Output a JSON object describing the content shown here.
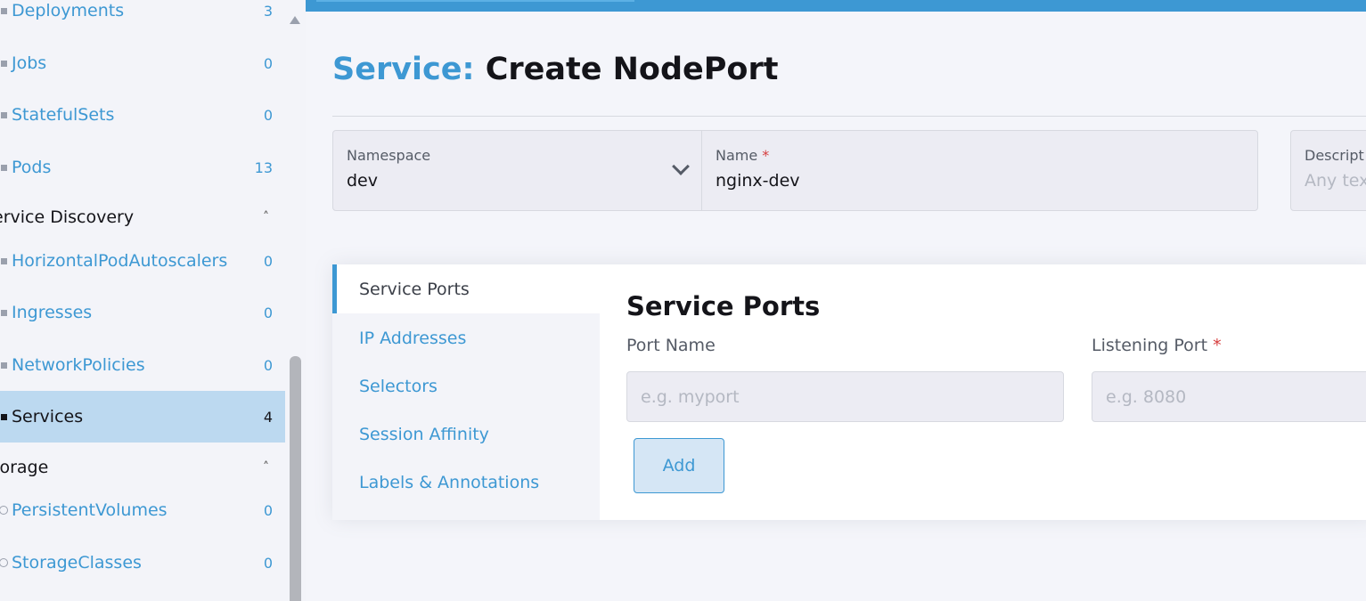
{
  "sidebar": {
    "items": [
      {
        "label": "Deployments",
        "count": "3"
      },
      {
        "label": "Jobs",
        "count": "0"
      },
      {
        "label": "StatefulSets",
        "count": "0"
      },
      {
        "label": "Pods",
        "count": "13"
      }
    ],
    "groups": [
      {
        "label": "ervice Discovery",
        "items": [
          {
            "label": "HorizontalPodAutoscalers",
            "count": "0"
          },
          {
            "label": "Ingresses",
            "count": "0"
          },
          {
            "label": "NetworkPolicies",
            "count": "0"
          },
          {
            "label": "Services",
            "count": "4",
            "active": true
          }
        ]
      },
      {
        "label": "torage",
        "items": [
          {
            "label": "PersistentVolumes",
            "count": "0"
          },
          {
            "label": "StorageClasses",
            "count": "0"
          }
        ]
      }
    ]
  },
  "header": {
    "title_prefix": "Service:",
    "title": "Create NodePort"
  },
  "form": {
    "namespace": {
      "label": "Namespace",
      "value": "dev"
    },
    "name": {
      "label": "Name",
      "required": "*",
      "value": "nginx-dev"
    },
    "description": {
      "label": "Descript",
      "placeholder": "Any tex"
    }
  },
  "tabs": [
    {
      "label": "Service Ports",
      "active": true
    },
    {
      "label": "IP Addresses"
    },
    {
      "label": "Selectors"
    },
    {
      "label": "Session Affinity"
    },
    {
      "label": "Labels & Annotations"
    }
  ],
  "panel": {
    "title": "Service Ports",
    "port_name": {
      "label": "Port Name",
      "placeholder": "e.g. myport"
    },
    "listening_port": {
      "label": "Listening Port",
      "required": "*",
      "placeholder": "e.g. 8080"
    },
    "add_label": "Add"
  }
}
